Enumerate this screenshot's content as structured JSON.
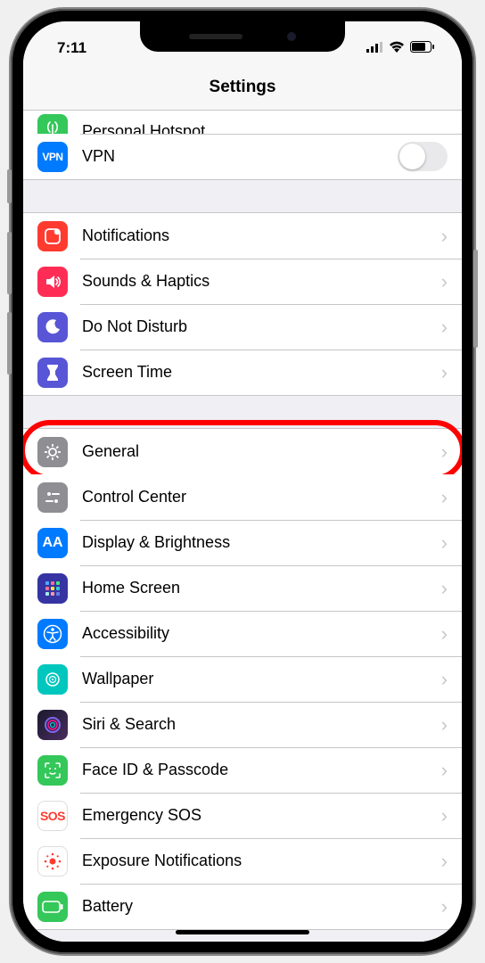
{
  "statusbar": {
    "time": "7:11"
  },
  "header": {
    "title": "Settings"
  },
  "section0": {
    "hotspot": {
      "label": "Personal Hotspot"
    },
    "vpn": {
      "label": "VPN",
      "icon_text": "VPN"
    }
  },
  "section1": {
    "notifications": {
      "label": "Notifications"
    },
    "sounds": {
      "label": "Sounds & Haptics"
    },
    "dnd": {
      "label": "Do Not Disturb"
    },
    "screentime": {
      "label": "Screen Time"
    }
  },
  "section2": {
    "general": {
      "label": "General"
    },
    "controlcenter": {
      "label": "Control Center"
    },
    "display": {
      "label": "Display & Brightness",
      "icon_text": "AA"
    },
    "homescreen": {
      "label": "Home Screen"
    },
    "accessibility": {
      "label": "Accessibility"
    },
    "wallpaper": {
      "label": "Wallpaper"
    },
    "siri": {
      "label": "Siri & Search"
    },
    "faceid": {
      "label": "Face ID & Passcode"
    },
    "sos": {
      "label": "Emergency SOS",
      "icon_text": "SOS"
    },
    "exposure": {
      "label": "Exposure Notifications"
    },
    "battery": {
      "label": "Battery"
    }
  }
}
